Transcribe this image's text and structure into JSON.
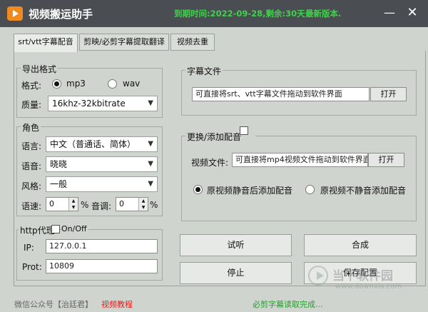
{
  "titlebar": {
    "title": "视频搬运助手",
    "expire": "到期时间:2022-09-28,剩余:30天",
    "version": "最新版本.",
    "minimize": "—",
    "close": "✕"
  },
  "tabs": [
    {
      "label": "srt/vtt字幕配音"
    },
    {
      "label": "剪映/必剪字幕提取翻译"
    },
    {
      "label": "视频去重"
    }
  ],
  "export": {
    "title": "导出格式",
    "format_label": "格式:",
    "options": [
      "mp3",
      "wav"
    ],
    "quality_label": "质量:",
    "quality_value": "16khz-32kbitrate"
  },
  "role": {
    "title": "角色",
    "language_label": "语言:",
    "language_value": "中文（普通话、简体）",
    "voice_label": "语音:",
    "voice_value": "晓晓",
    "style_label": "风格:",
    "style_value": "一般",
    "speed_label": "语速:",
    "speed_value": "0",
    "speed_unit": "%",
    "pitch_label": "音调:",
    "pitch_value": "0",
    "pitch_unit": "%"
  },
  "proxy": {
    "title": "http代理",
    "onoff_label": "On/Off",
    "ip_label": "IP:",
    "ip_value": "127.0.0.1",
    "port_label": "Prot:",
    "port_value": "10809"
  },
  "subtitle": {
    "title": "字幕文件",
    "placeholder": "可直接将srt、vtt字幕文件拖动到软件界面",
    "open": "打开"
  },
  "dubbing": {
    "title": "更换/添加配音",
    "video_label": "视频文件:",
    "video_placeholder": "可直接将mp4视频文件拖动到软件界面",
    "open": "打开",
    "option1": "原视频静音后添加配音",
    "option2": "原视频不静音添加配音"
  },
  "actions": {
    "preview": "试听",
    "synthesize": "合成",
    "stop": "停止",
    "save_config": "保存配置"
  },
  "footer": {
    "wechat": "微信公众号【治廷君】",
    "tutorial": "视频教程",
    "status": "必剪字幕读取完成..."
  },
  "watermark": {
    "text": "当下软件园",
    "sub": "www.downxia.com"
  },
  "colors": {
    "titlebar_bg": "#4a4d52",
    "accent_green": "#3dd34a",
    "status_green": "#22a22a",
    "tutorial_red": "#e02020",
    "window_bg": "#cfd4ce"
  }
}
